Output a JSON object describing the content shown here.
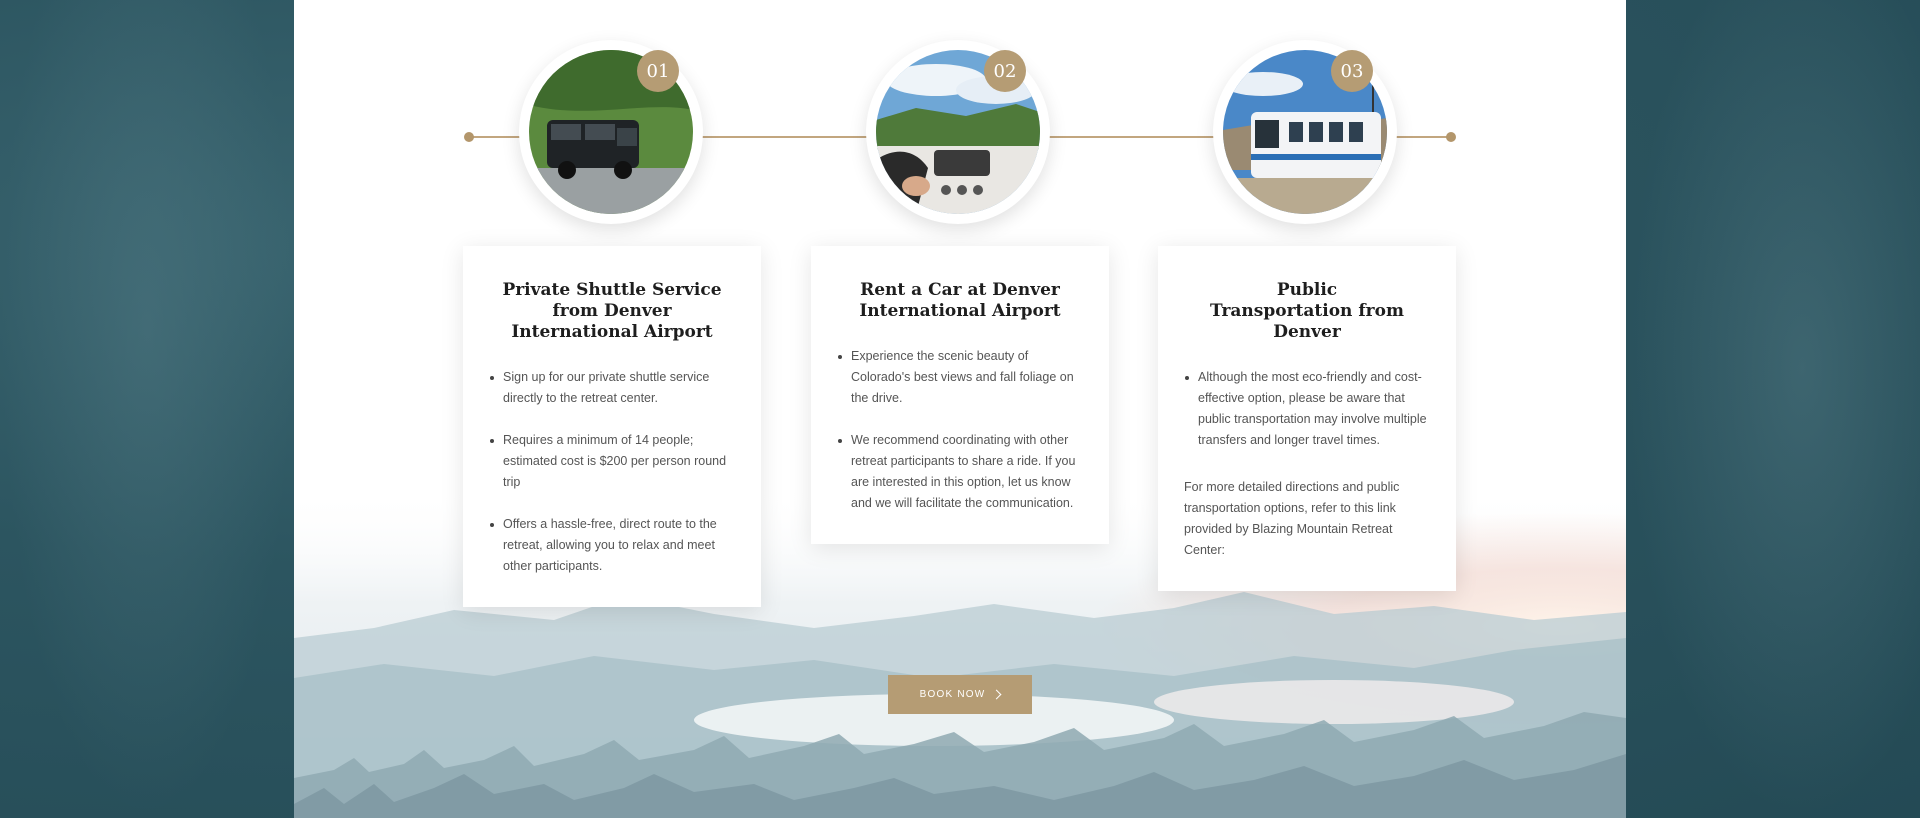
{
  "steps": [
    {
      "number": "01",
      "photo_icon": "shuttle-van-photo",
      "title": "Private Shuttle Service from Denver International Airport",
      "bullets": [
        "Sign up for our private shuttle service directly to the retreat center.",
        "Requires a minimum of 14 people; estimated cost is $200 per person round trip",
        "Offers a hassle-free, direct route to the retreat, allowing you to relax and meet other participants."
      ]
    },
    {
      "number": "02",
      "photo_icon": "rental-car-photo",
      "title": "Rent a Car at Denver International Airport",
      "bullets": [
        "Experience the scenic beauty of Colorado's best views and fall foliage on the drive.",
        "We recommend coordinating with other retreat participants to share a ride. If you are interested in this option, let us know and we will facilitate the communication."
      ]
    },
    {
      "number": "03",
      "photo_icon": "light-rail-train-photo",
      "title": "Public Transportation from Denver",
      "bullets": [
        "Although the most eco-friendly and cost-effective option, please be aware that public transportation may involve multiple transfers and longer travel times."
      ],
      "note": "For more detailed directions and public transportation options, refer to this link provided by Blazing Mountain Retreat Center:"
    }
  ],
  "cta": {
    "label": "BOOK NOW",
    "icon": "chevron-right-icon"
  },
  "colors": {
    "accent_gold": "#b59c74",
    "side_teal": "#2c5560",
    "page_background": "#ffffff"
  }
}
